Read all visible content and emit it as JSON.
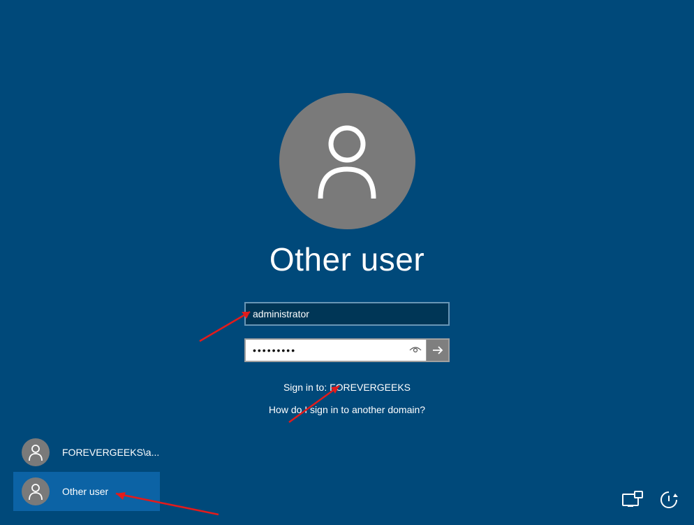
{
  "title": "Other user",
  "username": {
    "value": "administrator"
  },
  "password": {
    "value": "•••••••••"
  },
  "signinto": "Sign in to: FOREVERGEEKS",
  "domain_help": "How do I sign in to another domain?",
  "users": [
    {
      "label": "FOREVERGEEKS\\a..."
    },
    {
      "label": "Other user"
    }
  ]
}
